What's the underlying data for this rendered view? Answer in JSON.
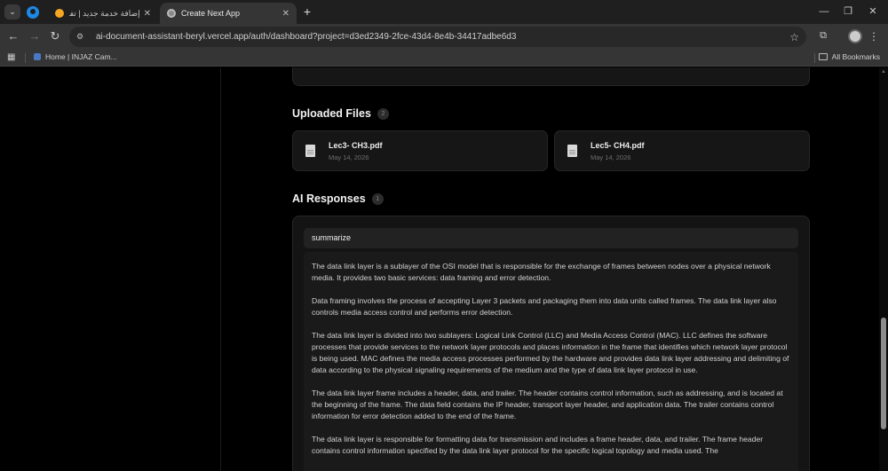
{
  "browser": {
    "tabs": [
      {
        "title": "إضافة خدمة جديد | تفذلي (3)",
        "active": false
      },
      {
        "title": "Create Next App",
        "active": true
      }
    ],
    "address": "ai-document-assistant-beryl.vercel.app/auth/dashboard?project=d3ed2349-2fce-43d4-8e4b-34417adbe6d3",
    "bookmarks": {
      "items": [
        {
          "label": "Home | INJAZ Cam..."
        }
      ],
      "all_label": "All Bookmarks"
    }
  },
  "uploaded_files": {
    "title": "Uploaded Files",
    "count": "2",
    "files": [
      {
        "name": "Lec3- CH3.pdf",
        "date": "May 14, 2026"
      },
      {
        "name": "Lec5- CH4.pdf",
        "date": "May 14, 2026"
      }
    ]
  },
  "ai_responses": {
    "title": "AI Responses",
    "count": "1",
    "items": [
      {
        "prompt": "summarize",
        "paragraphs": [
          "The data link layer is a sublayer of the OSI model that is responsible for the exchange of frames between nodes over a physical network media. It provides two basic services: data framing and error detection.",
          "Data framing involves the process of accepting Layer 3 packets and packaging them into data units called frames. The data link layer also controls media access control and performs error detection.",
          "The data link layer is divided into two sublayers: Logical Link Control (LLC) and Media Access Control (MAC). LLC defines the software processes that provide services to the network layer protocols and places information in the frame that identifies which network layer protocol is being used. MAC defines the media access processes performed by the hardware and provides data link layer addressing and delimiting of data according to the physical signaling requirements of the medium and the type of data link layer protocol in use.",
          "The data link layer frame includes a header, data, and trailer. The header contains control information, such as addressing, and is located at the beginning of the frame. The data field contains the IP header, transport layer header, and application data. The trailer contains control information for error detection added to the end of the frame.",
          "The data link layer is responsible for formatting data for transmission and includes a frame header, data, and trailer. The frame header contains control information specified by the data link layer protocol for the specific logical topology and media used. The"
        ]
      }
    ]
  },
  "colors": {
    "page_bg": "#000000",
    "card_bg": "#161616",
    "accent_icon": "#1e88e5"
  }
}
